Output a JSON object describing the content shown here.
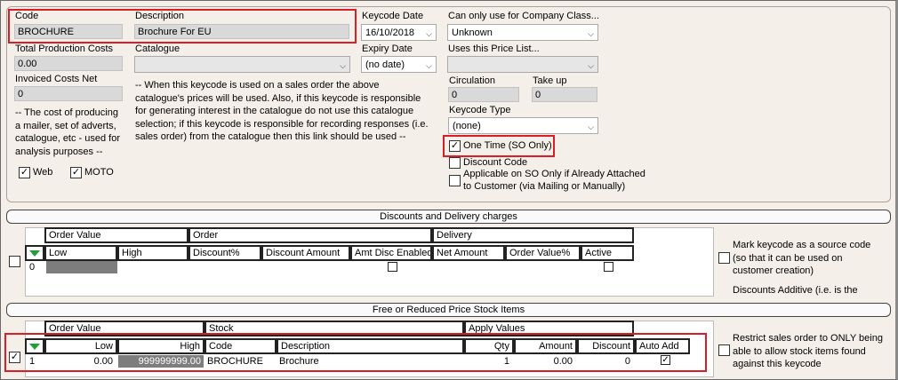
{
  "keycode": {
    "code_label": "Code",
    "code_value": "BROCHURE",
    "description_label": "Description",
    "description_value": "Brochure For EU",
    "keycode_date_label": "Keycode Date",
    "keycode_date_value": "16/10/2018",
    "company_class_label": "Can only use for Company Class...",
    "company_class_value": "Unknown",
    "total_costs_label": "Total Production Costs",
    "total_costs_value": "0.00",
    "catalogue_label": "Catalogue",
    "catalogue_value": "",
    "expiry_date_label": "Expiry Date",
    "expiry_date_value": "(no date)",
    "price_list_label": "Uses this Price List...",
    "price_list_value": "",
    "invoiced_costs_label": "Invoiced Costs Net",
    "invoiced_costs_value": "0",
    "catalogue_note": "-- When this keycode is used on a sales order the above catalogue's prices will be used. Also, if this keycode is responsible for generating interest in the catalogue do not use this catalogue selection; if this keycode is responsible for recording responses (i.e. sales order) from the catalogue then this link should be used --",
    "cost_note": "-- The cost of producing a mailer, set of adverts, catalogue, etc - used for analysis purposes --",
    "circulation_label": "Circulation",
    "circulation_value": "0",
    "take_up_label": "Take up",
    "take_up_value": "0",
    "keycode_type_label": "Keycode Type",
    "keycode_type_value": "(none)",
    "one_time_label": "One Time (SO Only)",
    "one_time_checked": true,
    "discount_code_label": "Discount Code",
    "discount_code_checked": false,
    "applicable_label_line1": "Applicable on SO Only if Already Attached",
    "applicable_label_line2": "to Customer (via Mailing or Manually)",
    "applicable_checked": false,
    "web_label": "Web",
    "web_checked": true,
    "moto_label": "MOTO",
    "moto_checked": true
  },
  "discounts": {
    "title": "Discounts and Delivery charges",
    "group_order_value": "Order Value",
    "group_order": "Order",
    "group_delivery": "Delivery",
    "columns": [
      "Low",
      "High",
      "Discount%",
      "Discount Amount",
      "Amt Disc Enabled",
      "Net Amount",
      "Order Value%",
      "Active"
    ],
    "row_index": "0",
    "mark_source_label": "Mark keycode as a source code (so that it can be used on customer creation)",
    "mark_source_checked": false,
    "additive_label": "Discounts Additive (i.e. is the"
  },
  "stock": {
    "title": "Free or Reduced Price Stock Items",
    "group_order_value": "Order Value",
    "group_stock": "Stock",
    "group_apply": "Apply Values",
    "columns": [
      "Low",
      "High",
      "Code",
      "Description",
      "Qty",
      "Amount",
      "Discount",
      "Auto Add"
    ],
    "row": {
      "index": "1",
      "low": "0.00",
      "high": "999999999.00",
      "code": "BROCHURE",
      "description": "Brochure",
      "qty": "1",
      "amount": "0.00",
      "discount": "0",
      "auto_add": true
    },
    "row_select_checked": true,
    "restrict_label": "Restrict sales order to ONLY being able to allow stock items found against this keycode",
    "restrict_checked": false
  },
  "icons": {
    "dropdown": "chevron-down-icon",
    "grid_filter": "green-triangle-icon",
    "check": "check-icon"
  },
  "colors": {
    "highlight": "#d91e27",
    "background": "#f4f0e9",
    "filter_icon": "#1f9e3a"
  }
}
